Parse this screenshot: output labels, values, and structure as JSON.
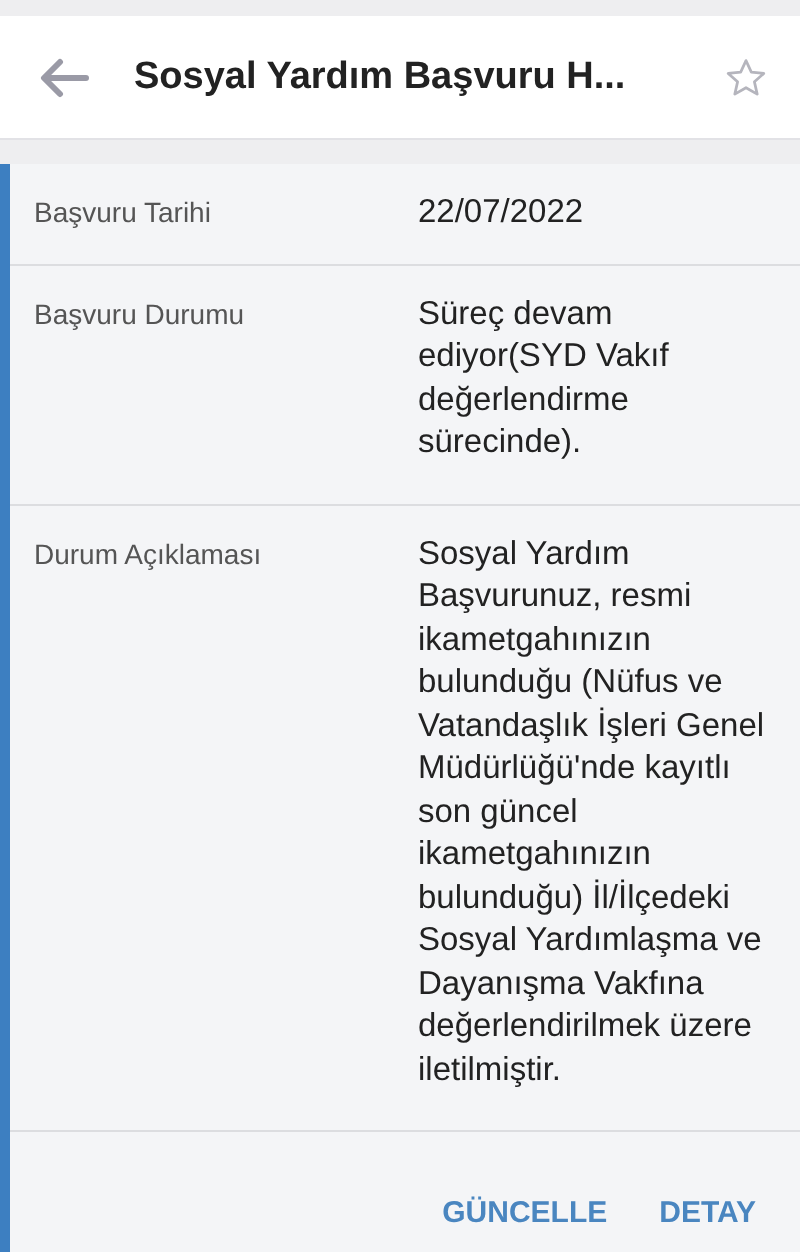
{
  "header": {
    "title": "Sosyal Yardım Başvuru H...",
    "starred": false
  },
  "details": [
    {
      "label": "Başvuru Tarihi",
      "value": "22/07/2022"
    },
    {
      "label": "Başvuru Durumu",
      "value": "Süreç devam ediyor(SYD Vakıf değerlendirme sürecinde)."
    },
    {
      "label": "Durum Açıklaması",
      "value": "Sosyal Yardım Başvurunuz, resmi ikametgahınızın bulunduğu (Nüfus ve Vatandaşlık İşleri Genel Müdürlüğü'nde kayıtlı son güncel ikametgahınızın bulunduğu) İl/İlçedeki Sosyal Yardımlaşma ve Dayanışma Vakfına değerlendirilmek üzere iletilmiştir."
    }
  ],
  "actions": [
    "GÜNCELLE",
    "DETAY"
  ]
}
